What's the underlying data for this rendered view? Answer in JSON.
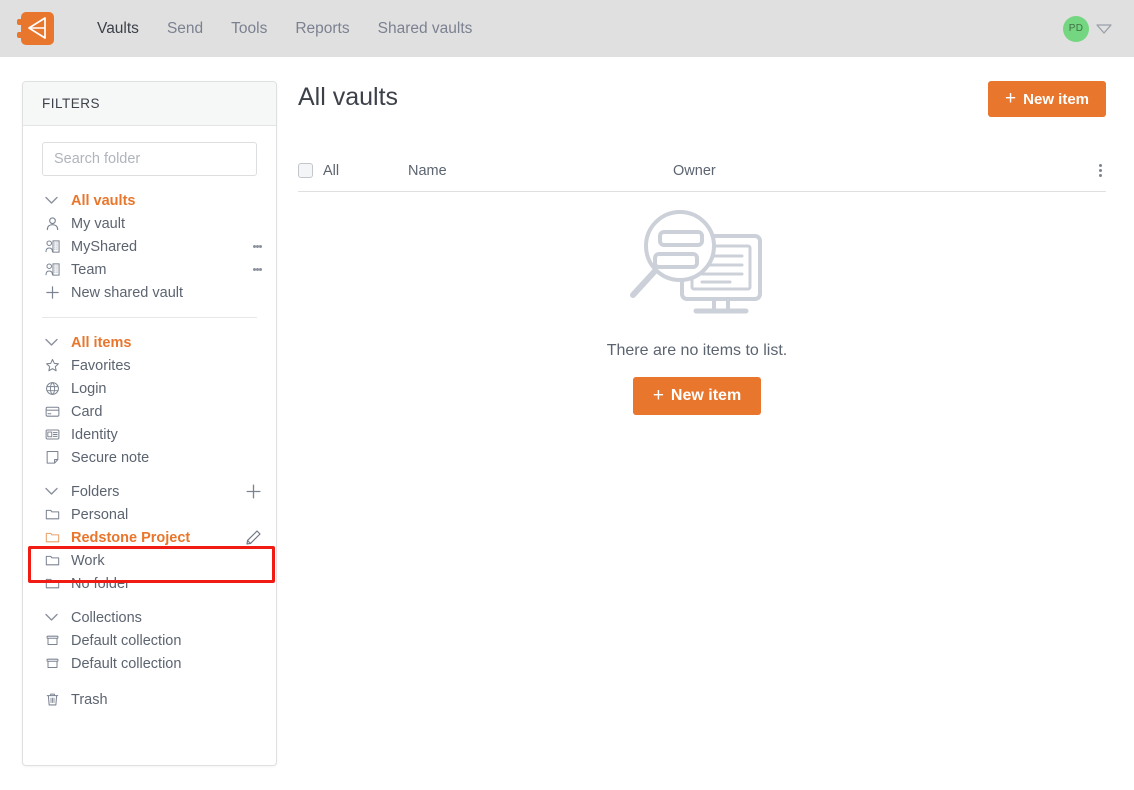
{
  "topbar": {
    "logo_icon": "bitwarden-shield-logo",
    "nav": [
      {
        "label": "Vaults",
        "active": true
      },
      {
        "label": "Send",
        "active": false
      },
      {
        "label": "Tools",
        "active": false
      },
      {
        "label": "Reports",
        "active": false
      },
      {
        "label": "Shared vaults",
        "active": false
      }
    ],
    "avatar_initials": "PD",
    "avatar_color": "#74d680",
    "caret_icon": "chevron-down-icon"
  },
  "sidebar": {
    "header": "FILTERS",
    "search": {
      "placeholder": "Search folder",
      "value": ""
    },
    "vaults_group": {
      "label": "All vaults",
      "chevron_icon": "chevron-down-icon",
      "items": [
        {
          "label": "My vault",
          "icon": "person-icon",
          "has_menu": false
        },
        {
          "label": "MyShared",
          "icon": "organization-icon",
          "has_menu": true
        },
        {
          "label": "Team",
          "icon": "organization-icon",
          "has_menu": true
        },
        {
          "label": "New shared vault",
          "icon": "plus-icon",
          "has_menu": false
        }
      ]
    },
    "items_group": {
      "label": "All items",
      "chevron_icon": "chevron-down-icon",
      "items": [
        {
          "label": "Favorites",
          "icon": "star-icon"
        },
        {
          "label": "Login",
          "icon": "globe-icon"
        },
        {
          "label": "Card",
          "icon": "credit-card-icon"
        },
        {
          "label": "Identity",
          "icon": "id-card-icon"
        },
        {
          "label": "Secure note",
          "icon": "sticky-note-icon"
        }
      ]
    },
    "folders_group": {
      "label": "Folders",
      "chevron_icon": "chevron-down-icon",
      "add_icon": "plus-icon",
      "items": [
        {
          "label": "Personal",
          "icon": "folder-icon",
          "selected": false
        },
        {
          "label": "Redstone Project",
          "icon": "folder-icon",
          "selected": true,
          "edit_icon": "pencil-icon"
        },
        {
          "label": "Work",
          "icon": "folder-icon",
          "selected": false
        },
        {
          "label": "No folder",
          "icon": "folder-icon",
          "selected": false
        }
      ]
    },
    "collections_group": {
      "label": "Collections",
      "chevron_icon": "chevron-down-icon",
      "items": [
        {
          "label": "Default collection",
          "icon": "collection-icon"
        },
        {
          "label": "Default collection",
          "icon": "collection-icon"
        }
      ]
    },
    "trash": {
      "label": "Trash",
      "icon": "trash-icon"
    }
  },
  "main": {
    "title": "All vaults",
    "new_item_top_label": "New item",
    "new_item_center_label": "New item",
    "plus_glyph": "+",
    "table": {
      "checkbox_checked": false,
      "columns": [
        {
          "key": "all",
          "label": "All"
        },
        {
          "key": "name",
          "label": "Name"
        },
        {
          "key": "owner",
          "label": "Owner"
        }
      ],
      "kebab_icon": "more-vertical-icon",
      "rows": []
    },
    "empty_state": {
      "illustration_icon": "search-monitor-illustration",
      "message": "There are no items to list."
    }
  },
  "annotation": {
    "highlight_target": "Redstone Project",
    "box_color": "#f01c14"
  },
  "theme": {
    "accent": "#e8762c",
    "topbar_bg": "#e0e0e0",
    "text": "#5c6470",
    "title": "#3c4049",
    "border": "#dfe0e2"
  }
}
